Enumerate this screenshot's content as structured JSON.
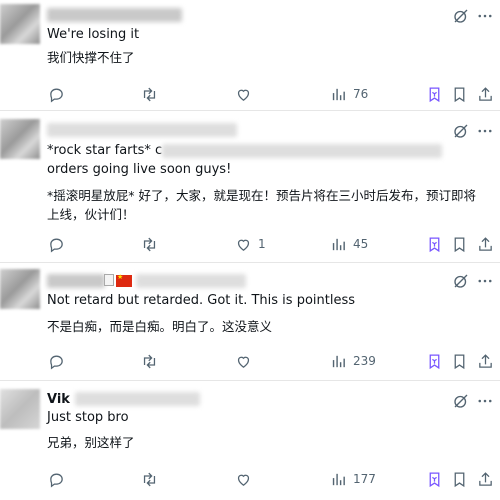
{
  "posts": [
    {
      "author_name": "",
      "lines": [
        "We're losing it",
        "我们快撑不住了"
      ],
      "stats": {
        "replies": "",
        "reposts": "",
        "likes": "",
        "views": "76"
      }
    },
    {
      "author_name": "",
      "lines": [
        "*rock star farts* c",
        "orders going live soon guys!",
        "*摇滚明星放屁* 好了，大家，就是现在！预告片将在三小时后发布，预订即将",
        "上线，伙计们！"
      ],
      "stats": {
        "replies": "",
        "reposts": "",
        "likes": "1",
        "views": "45"
      }
    },
    {
      "author_name": "",
      "lines": [
        "Not retard but retarded. Got it. This is pointless",
        "不是白痴，而是白痴。明白了。这没意义"
      ],
      "stats": {
        "replies": "",
        "reposts": "",
        "likes": "",
        "views": "239"
      }
    },
    {
      "author_name": "Vik",
      "lines": [
        "Just stop bro",
        "兄弟，别这样了"
      ],
      "stats": {
        "replies": "",
        "reposts": "",
        "likes": "",
        "views": "177"
      }
    }
  ],
  "colors": {
    "icon": "#536471",
    "accent": "#7856ff",
    "text": "#0f1419"
  },
  "icons": [
    "reply-icon",
    "repost-icon",
    "like-icon",
    "views-icon",
    "bookmark-extension-icon",
    "bookmark-icon",
    "share-icon",
    "grok-icon",
    "more-icon"
  ]
}
